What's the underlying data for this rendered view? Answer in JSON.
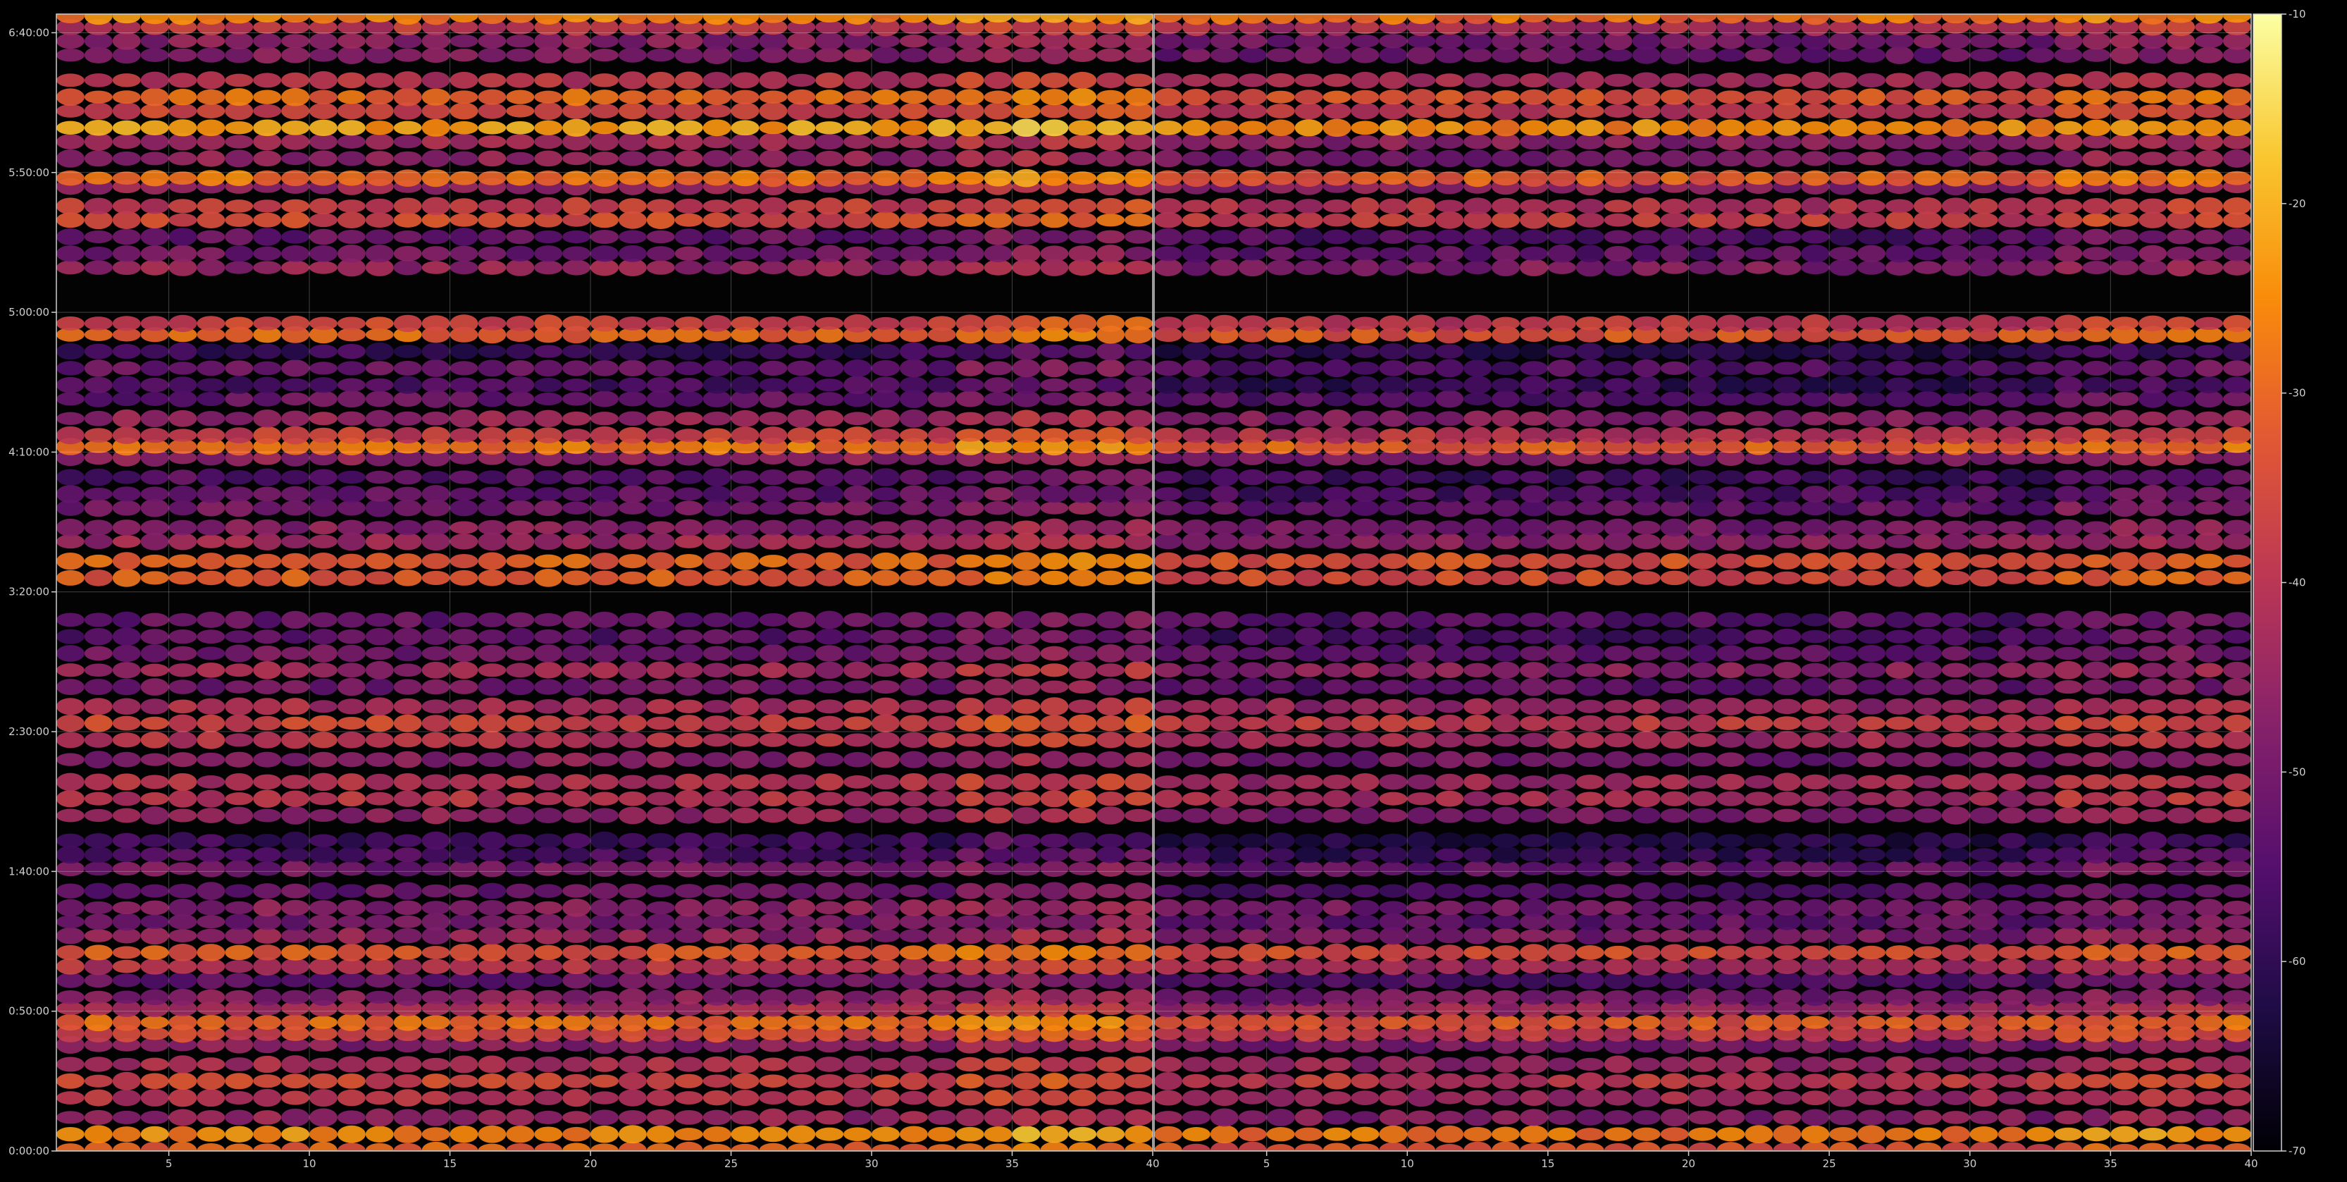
{
  "chart_data": {
    "type": "heatmap",
    "title": "",
    "colormap": "inferno",
    "panels": [
      {
        "name": "",
        "xlim": [
          1,
          40
        ],
        "x_ticks": [
          5,
          10,
          15,
          20,
          25,
          30,
          35,
          40
        ],
        "x_tick_labels": [
          "5",
          "10",
          "15",
          "20",
          "25",
          "30",
          "35",
          "40"
        ],
        "ylim_seconds": [
          0,
          24400
        ],
        "y_ticks_seconds": [
          0,
          3000,
          6000,
          9000,
          12000,
          15000,
          18000,
          21000,
          24000
        ],
        "y_tick_labels": [
          "0:00:00",
          "0:50:00",
          "1:40:00",
          "2:30:00",
          "3:20:00",
          "4:10:00",
          "5:00:00",
          "5:50:00",
          "6:40:00"
        ],
        "grid": true
      },
      {
        "name": "",
        "xlim": [
          1,
          40
        ],
        "x_ticks": [
          5,
          10,
          15,
          20,
          25,
          30,
          35,
          40
        ],
        "x_tick_labels": [
          "5",
          "10",
          "15",
          "20",
          "25",
          "30",
          "35",
          "40"
        ],
        "ylim_seconds": [
          0,
          24400
        ],
        "grid": true
      }
    ],
    "colorbar": {
      "range": [
        -70,
        -10
      ],
      "ticks": [
        -10,
        -20,
        -30,
        -40,
        -50,
        -60,
        -70
      ],
      "tick_labels": [
        "-10",
        "-20",
        "-30",
        "-40",
        "-50",
        "-60",
        "-70"
      ]
    },
    "approx_bands": [
      {
        "time": "0:00:10",
        "level": -31
      },
      {
        "time": "0:06:00",
        "level": -25
      },
      {
        "time": "0:12:00",
        "level": -45
      },
      {
        "time": "0:19:00",
        "level": -40
      },
      {
        "time": "0:25:00",
        "level": -36
      },
      {
        "time": "0:31:00",
        "level": -42
      },
      {
        "time": "0:38:00",
        "level": -47
      },
      {
        "time": "0:42:00",
        "level": -36
      },
      {
        "time": "0:46:00",
        "level": -30
      },
      {
        "time": "0:51:00",
        "level": -41
      },
      {
        "time": "0:55:00",
        "level": -47
      },
      {
        "time": "1:01:00",
        "level": -52
      },
      {
        "time": "1:06:00",
        "level": -40
      },
      {
        "time": "1:11:00",
        "level": -32
      },
      {
        "time": "1:17:00",
        "level": -46
      },
      {
        "time": "1:22:00",
        "level": -50
      },
      {
        "time": "1:27:00",
        "level": -47
      },
      {
        "time": "1:33:00",
        "level": -52
      },
      {
        "time": "1:41:00",
        "level": -50
      },
      {
        "time": "1:46:00",
        "level": -56
      },
      {
        "time": "1:51:00",
        "level": -58
      },
      {
        "time": "2:00:00",
        "level": -46
      },
      {
        "time": "2:06:00",
        "level": -40
      },
      {
        "time": "2:12:00",
        "level": -41
      },
      {
        "time": "2:20:00",
        "level": -47
      },
      {
        "time": "2:27:00",
        "level": -40
      },
      {
        "time": "2:33:00",
        "level": -36
      },
      {
        "time": "2:39:00",
        "level": -42
      },
      {
        "time": "2:46:00",
        "level": -50
      },
      {
        "time": "2:52:00",
        "level": -44
      },
      {
        "time": "2:58:00",
        "level": -50
      },
      {
        "time": "3:04:00",
        "level": -54
      },
      {
        "time": "3:10:00",
        "level": -52
      },
      {
        "time": "3:25:00",
        "level": -32
      },
      {
        "time": "3:31:00",
        "level": -31
      },
      {
        "time": "3:38:00",
        "level": -44
      },
      {
        "time": "3:43:00",
        "level": -47
      },
      {
        "time": "3:50:00",
        "level": -50
      },
      {
        "time": "3:55:00",
        "level": -53
      },
      {
        "time": "4:01:00",
        "level": -54
      },
      {
        "time": "4:08:00",
        "level": -46
      },
      {
        "time": "4:12:00",
        "level": -28
      },
      {
        "time": "4:16:00",
        "level": -37
      },
      {
        "time": "4:22:00",
        "level": -45
      },
      {
        "time": "4:29:00",
        "level": -52
      },
      {
        "time": "4:34:00",
        "level": -56
      },
      {
        "time": "4:40:00",
        "level": -52
      },
      {
        "time": "4:46:00",
        "level": -58
      },
      {
        "time": "4:52:00",
        "level": -30
      },
      {
        "time": "4:56:00",
        "level": -36
      },
      {
        "time": "5:16:00",
        "level": -45
      },
      {
        "time": "5:21:00",
        "level": -50
      },
      {
        "time": "5:27:00",
        "level": -52
      },
      {
        "time": "5:33:00",
        "level": -35
      },
      {
        "time": "5:38:00",
        "level": -38
      },
      {
        "time": "5:45:00",
        "level": -44
      },
      {
        "time": "5:48:00",
        "level": -28
      },
      {
        "time": "5:55:00",
        "level": -46
      },
      {
        "time": "6:01:00",
        "level": -44
      },
      {
        "time": "6:06:00",
        "level": -22
      },
      {
        "time": "6:12:00",
        "level": -36
      },
      {
        "time": "6:17:00",
        "level": -30
      },
      {
        "time": "6:23:00",
        "level": -40
      },
      {
        "time": "6:32:00",
        "level": -48
      },
      {
        "time": "6:37:00",
        "level": -47
      },
      {
        "time": "6:42:00",
        "level": -39
      },
      {
        "time": "6:46:00",
        "level": -26
      }
    ]
  }
}
